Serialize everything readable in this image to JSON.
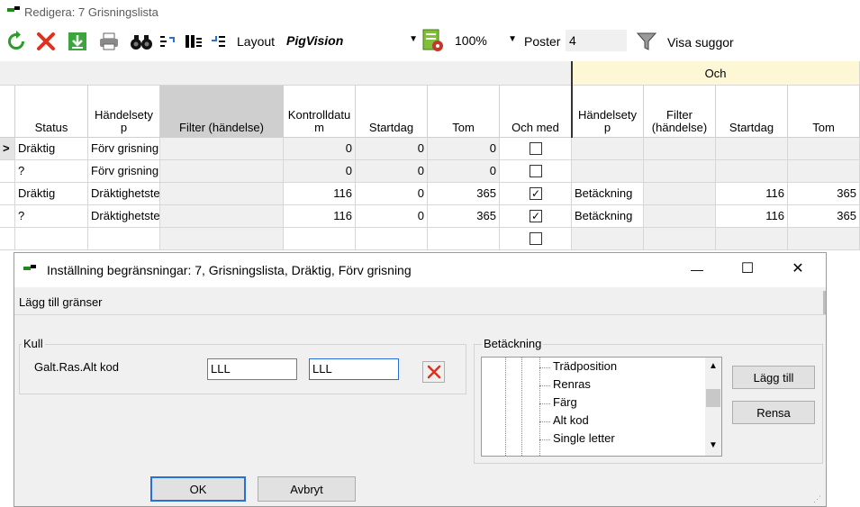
{
  "window": {
    "title": "Redigera: 7 Grisningslista"
  },
  "toolbar": {
    "layout_label": "Layout",
    "layout_value": "PigVision",
    "zoom_value": "100%",
    "poster_label": "Poster",
    "poster_value": "4",
    "filter_label": "Visa suggor",
    "icons": [
      "refresh-icon",
      "delete-icon",
      "download-icon",
      "print-icon",
      "binoculars-icon",
      "expand-icon",
      "columns-icon",
      "collapse-icon",
      "settings-icon",
      "filter-icon"
    ]
  },
  "grid": {
    "group_header": "Och",
    "columns": [
      "Status",
      "Händelsety\np",
      "Filter (händelse)",
      "Kontrolldatu\nm",
      "Startdag",
      "Tom",
      "Och med",
      "Händelsety\np",
      "Filter\n(händelse)",
      "Startdag",
      "Tom"
    ],
    "row_marker": ">",
    "rows": [
      {
        "status": "Dräktig",
        "event": "Förv grisning",
        "filter": "",
        "kontroll": "0",
        "start": "0",
        "tom": "0",
        "ochmed": false,
        "event2": "",
        "filter2": "",
        "start2": "",
        "tom2": ""
      },
      {
        "status": "?",
        "event": "Förv grisning",
        "filter": "",
        "kontroll": "0",
        "start": "0",
        "tom": "0",
        "ochmed": false,
        "event2": "",
        "filter2": "",
        "start2": "",
        "tom2": ""
      },
      {
        "status": "Dräktig",
        "event": "Dräktighetste",
        "filter": "",
        "kontroll": "116",
        "start": "0",
        "tom": "365",
        "ochmed": true,
        "event2": "Betäckning",
        "filter2": "",
        "start2": "116",
        "tom2": "365"
      },
      {
        "status": "?",
        "event": "Dräktighetste",
        "filter": "",
        "kontroll": "116",
        "start": "0",
        "tom": "365",
        "ochmed": true,
        "event2": "Betäckning",
        "filter2": "",
        "start2": "116",
        "tom2": "365"
      },
      {
        "status": "",
        "event": "",
        "filter": "",
        "kontroll": "",
        "start": "",
        "tom": "",
        "ochmed": false,
        "event2": "",
        "filter2": "",
        "start2": "",
        "tom2": ""
      }
    ]
  },
  "dialog": {
    "title": "Inställning begränsningar: 7, Grisningslista, Dräktig, Förv grisning",
    "subtitle": "Lägg till gränser",
    "kull": {
      "legend": "Kull",
      "field_label": "Galt.Ras.Alt kod",
      "value1": "LLL",
      "value2": "LLL"
    },
    "betackning": {
      "legend": "Betäckning",
      "items": [
        "Trädposition",
        "Renras",
        "Färg",
        "Alt kod",
        "Single letter"
      ],
      "add_button": "Lägg till",
      "clear_button": "Rensa"
    },
    "ok_button": "OK",
    "cancel_button": "Avbryt",
    "min_glyph": "—",
    "max_glyph": "☐",
    "close_glyph": "✕"
  },
  "colors": {
    "group_header_bg": "#fdf7d6",
    "selected_header_bg": "#cfcfcf",
    "accent_green": "#1e8a1e"
  }
}
